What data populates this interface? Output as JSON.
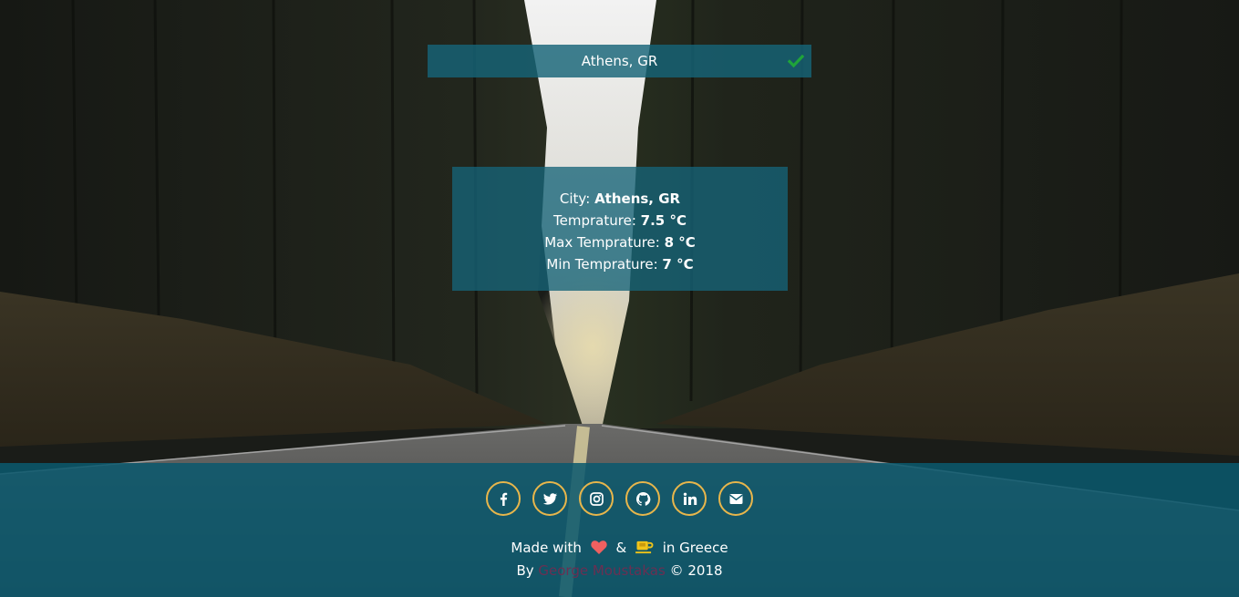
{
  "search": {
    "value": "Athens, GR",
    "submit_icon": "check-icon"
  },
  "weather": {
    "city_label": "City:",
    "city_value": "Athens, GR",
    "temp_label": "Temprature:",
    "temp_value": "7.5 °C",
    "max_label": "Max Temprature:",
    "max_value": "8 °C",
    "min_label": "Min Temprature:",
    "min_value": "7 °C"
  },
  "footer": {
    "social": [
      {
        "icon": "facebook-icon"
      },
      {
        "icon": "twitter-icon"
      },
      {
        "icon": "instagram-icon"
      },
      {
        "icon": "github-icon"
      },
      {
        "icon": "linkedin-icon"
      },
      {
        "icon": "envelope-icon"
      }
    ],
    "made_with_prefix": "Made with",
    "made_with_amp": "&",
    "made_with_suffix": "in Greece",
    "by_label": "By",
    "author": "George Moustakas",
    "copyright": "© 2018"
  },
  "colors": {
    "accent_ring": "#e8b64b",
    "panel": "#166478",
    "footer": "#0a586e",
    "heart": "#f06060",
    "coffee": "#f0c419",
    "check": "#1fa43a",
    "author_link": "#6b2f52"
  }
}
